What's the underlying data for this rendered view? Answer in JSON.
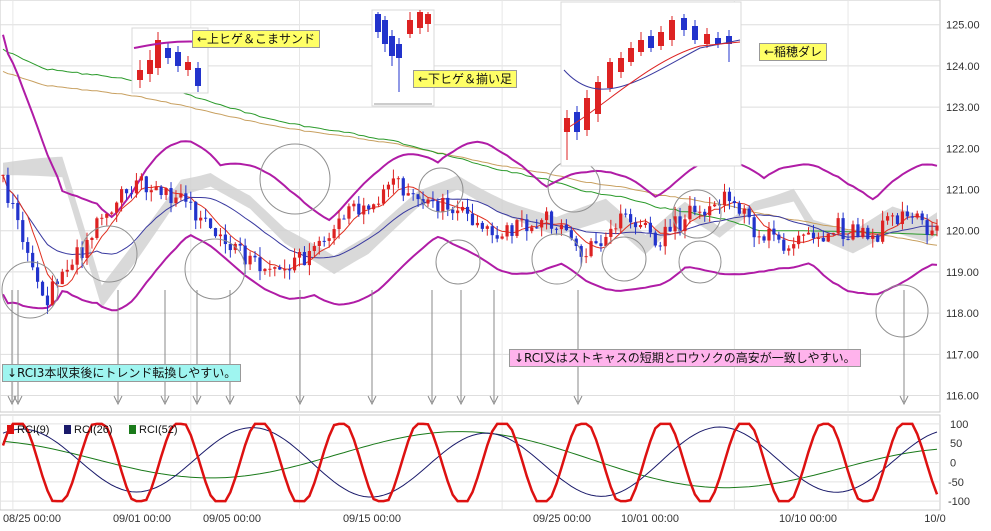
{
  "chart_data": [
    {
      "type": "candlestick",
      "title": "",
      "ylim": [
        115.6,
        125.6
      ],
      "y_ticks": [
        "125.00",
        "124.00",
        "123.00",
        "122.00",
        "121.00",
        "120.00",
        "119.00",
        "118.00",
        "117.00",
        "116.00"
      ],
      "y_tick_values": [
        125,
        124,
        123,
        122,
        121,
        120,
        119,
        118,
        117,
        116
      ],
      "x_ticks": [
        "08/25 00:00",
        "09/01 00:00",
        "09/05 00:00",
        "09/15 00:00",
        "09/25 00:00",
        "10/01 00:00",
        "10/10 00:00",
        "10/0"
      ],
      "grid": true,
      "colors": {
        "up": "#dd2222",
        "down": "#2233cc",
        "bollinger": "#b01ca6",
        "ma_short": "#e03020",
        "ma_mid": "#3a3aa0",
        "ma_long": "#2a9a2a",
        "ma_longer": "#c8a060",
        "cloud": "#cfcfcf"
      },
      "annotations": [
        {
          "text": "←上ヒゲ＆こまサンド"
        },
        {
          "text": "←下ヒゲ＆揃い足"
        },
        {
          "text": "←稲穂ダレ"
        },
        {
          "text": "↓RCI3本収束後にトレンド転換しやすい。"
        },
        {
          "text": "↓RCI又はストキャスの短期とロウソクの高安が一致しやすい。"
        }
      ]
    },
    {
      "type": "line",
      "ylim": [
        -110,
        110
      ],
      "y_ticks": [
        "100",
        "50",
        "0",
        "-50",
        "-100"
      ],
      "y_tick_values": [
        100,
        50,
        0,
        -50,
        -100
      ],
      "series": [
        {
          "name": "RCI(9)",
          "color": "#dd1111"
        },
        {
          "name": "RCI(26)",
          "color": "#1a1a6a"
        },
        {
          "name": "RCI(52)",
          "color": "#1a7a1a"
        }
      ]
    }
  ]
}
